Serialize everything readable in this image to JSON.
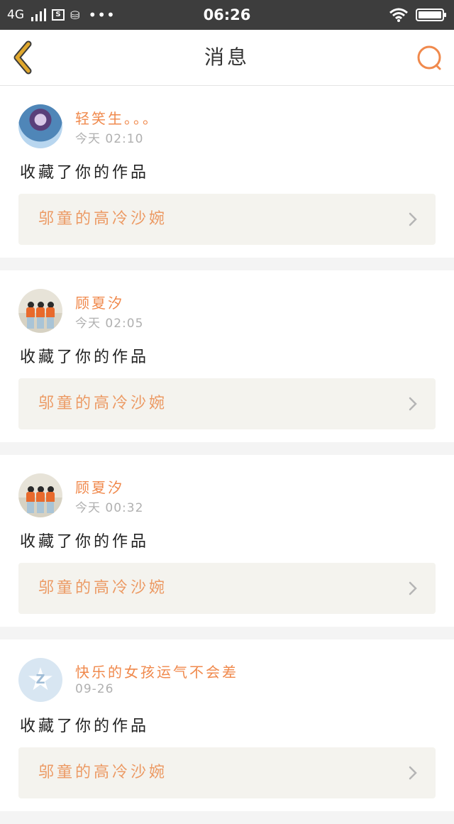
{
  "status_bar": {
    "network": "4G",
    "time": "06:26",
    "more": "•••"
  },
  "header": {
    "title": "消息",
    "back_icon": "chevron-left-icon",
    "search_icon": "search-icon"
  },
  "messages": [
    {
      "username": "轻笑生。。。",
      "time": "今天 02:10",
      "action": "收藏了你的作品",
      "work_title": "邬童的高冷沙婉",
      "avatar": "anime-girl-avatar"
    },
    {
      "username": "顾夏汐",
      "time": "今天 02:05",
      "action": "收藏了你的作品",
      "work_title": "邬童的高冷沙婉",
      "avatar": "group-photo-avatar"
    },
    {
      "username": "顾夏汐",
      "time": "今天 00:32",
      "action": "收藏了你的作品",
      "work_title": "邬童的高冷沙婉",
      "avatar": "group-photo-avatar"
    },
    {
      "username": "快乐的女孩运气不会差",
      "time": "09-26",
      "action": "收藏了你的作品",
      "work_title": "邬童的高冷沙婉",
      "avatar": "default-star-avatar"
    }
  ],
  "colors": {
    "accent": "#f0894c",
    "back_icon": "#e0a82e",
    "link_text": "#ec9a64",
    "status_bar": "#3d3d3d"
  }
}
